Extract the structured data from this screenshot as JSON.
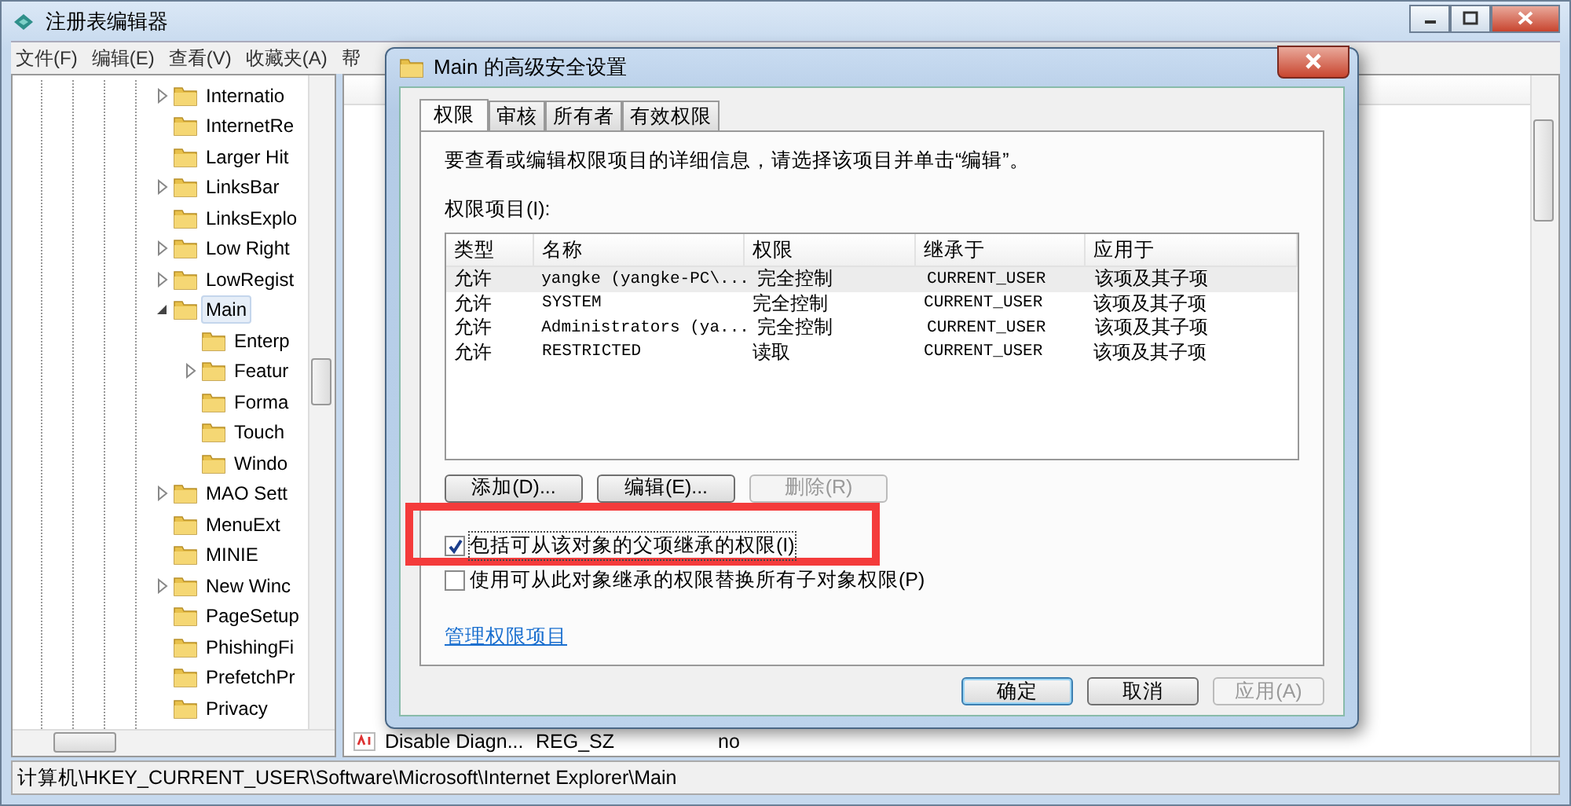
{
  "window": {
    "title": "注册表编辑器",
    "menu": [
      "文件(F)",
      "编辑(E)",
      "查看(V)",
      "收藏夹(A)",
      "帮"
    ]
  },
  "tree": [
    {
      "label": "Internatio",
      "kind": "collapsed",
      "selected": false
    },
    {
      "label": "InternetRe",
      "kind": "leaf",
      "selected": false
    },
    {
      "label": "Larger Hit",
      "kind": "leaf",
      "selected": false
    },
    {
      "label": "LinksBar",
      "kind": "collapsed",
      "selected": false
    },
    {
      "label": "LinksExplo",
      "kind": "leaf",
      "selected": false
    },
    {
      "label": "Low Right",
      "kind": "collapsed",
      "selected": false
    },
    {
      "label": "LowRegist",
      "kind": "collapsed",
      "selected": false
    },
    {
      "label": "Main",
      "kind": "expanded",
      "selected": true,
      "children": [
        {
          "label": "Enterp",
          "kind": "leaf",
          "selected": false
        },
        {
          "label": "Featur",
          "kind": "collapsed",
          "selected": false
        },
        {
          "label": "Forma",
          "kind": "leaf",
          "selected": false
        },
        {
          "label": "Touch",
          "kind": "leaf",
          "selected": false
        },
        {
          "label": "Windo",
          "kind": "leaf",
          "selected": false
        }
      ]
    },
    {
      "label": "MAO Sett",
      "kind": "collapsed",
      "selected": false
    },
    {
      "label": "MenuExt",
      "kind": "leaf",
      "selected": false
    },
    {
      "label": "MINIE",
      "kind": "leaf",
      "selected": false
    },
    {
      "label": "New Winc",
      "kind": "collapsed",
      "selected": false
    },
    {
      "label": "PageSetup",
      "kind": "leaf",
      "selected": false
    },
    {
      "label": "PhishingFi",
      "kind": "leaf",
      "selected": false
    },
    {
      "label": "PrefetchPr",
      "kind": "leaf",
      "selected": false
    },
    {
      "label": "Privacy",
      "kind": "leaf",
      "selected": false
    }
  ],
  "values_list": {
    "rows": [
      {
        "name": "Disable Diagn...",
        "type": "REG_SZ",
        "data": "no"
      }
    ]
  },
  "status_bar": "计算机\\HKEY_CURRENT_USER\\Software\\Microsoft\\Internet Explorer\\Main",
  "dialog": {
    "title": "Main 的高级安全设置",
    "tabs": [
      {
        "label": "权限",
        "selected": true
      },
      {
        "label": "审核",
        "selected": false
      },
      {
        "label": "所有者",
        "selected": false
      },
      {
        "label": "有效权限",
        "selected": false
      }
    ],
    "instruction": "要查看或编辑权限项目的详细信息，请选择该项目并单击“编辑”。",
    "list_label": "权限项目(I):",
    "table": {
      "columns": [
        "类型",
        "名称",
        "权限",
        "继承于",
        "应用于"
      ],
      "rows": [
        {
          "cells": [
            "允许",
            "yangke (yangke-PC\\...",
            "完全控制",
            "CURRENT_USER",
            "该项及其子项"
          ],
          "selected": true
        },
        {
          "cells": [
            "允许",
            "SYSTEM",
            "完全控制",
            "CURRENT_USER",
            "该项及其子项"
          ],
          "selected": false
        },
        {
          "cells": [
            "允许",
            "Administrators (ya...",
            "完全控制",
            "CURRENT_USER",
            "该项及其子项"
          ],
          "selected": false
        },
        {
          "cells": [
            "允许",
            "RESTRICTED",
            "读取",
            "CURRENT_USER",
            "该项及其子项"
          ],
          "selected": false
        }
      ]
    },
    "buttons": [
      {
        "label": "添加(D)...",
        "disabled": false
      },
      {
        "label": "编辑(E)...",
        "disabled": false
      },
      {
        "label": "删除(R)",
        "disabled": true
      }
    ],
    "checkboxes": [
      {
        "label": "包括可从该对象的父项继承的权限(I)",
        "checked": true,
        "highlighted": true
      },
      {
        "label": "使用可从此对象继承的权限替换所有子对象权限(P)",
        "checked": false,
        "highlighted": false
      }
    ],
    "link": "管理权限项目",
    "footer_buttons": [
      {
        "label": "确定",
        "default": true,
        "disabled": false
      },
      {
        "label": "取消",
        "default": false,
        "disabled": false
      },
      {
        "label": "应用(A)",
        "default": false,
        "disabled": true
      }
    ]
  }
}
